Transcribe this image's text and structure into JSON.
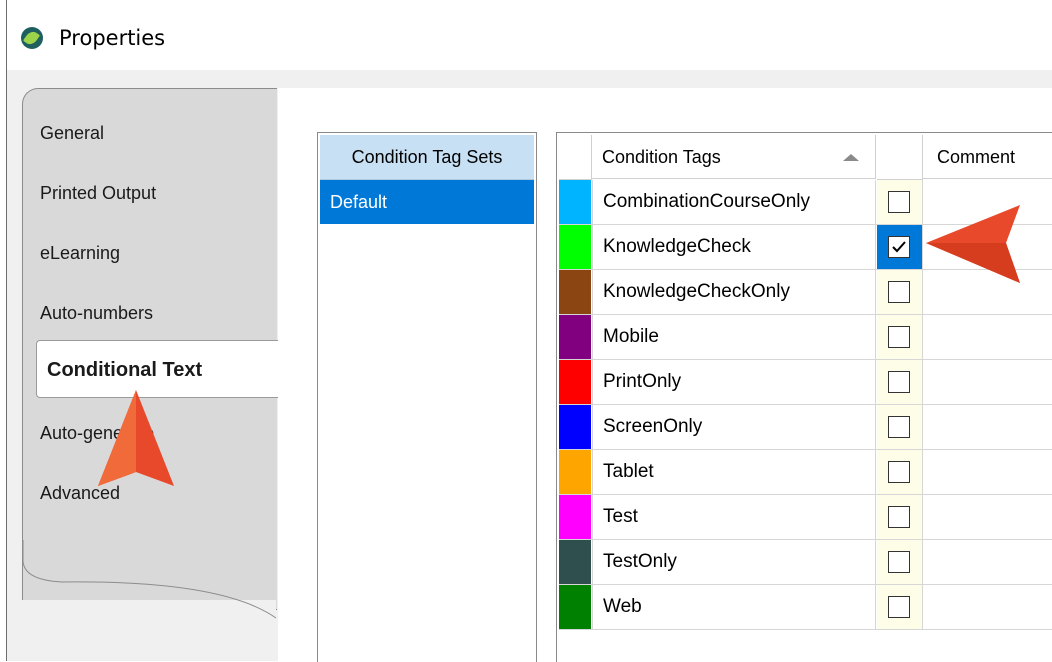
{
  "window": {
    "title": "Properties",
    "icon": "app-leaf-icon"
  },
  "tabs": [
    {
      "label": "General",
      "active": false
    },
    {
      "label": "Printed Output",
      "active": false
    },
    {
      "label": "eLearning",
      "active": false
    },
    {
      "label": "Auto-numbers",
      "active": false
    },
    {
      "label": "Conditional Text",
      "active": true
    },
    {
      "label": "Auto-generate",
      "active": false
    },
    {
      "label": "Advanced",
      "active": false
    }
  ],
  "tag_sets": {
    "header": "Condition Tag Sets",
    "items": [
      {
        "label": "Default",
        "selected": true
      }
    ]
  },
  "tags_grid": {
    "headers": {
      "tags": "Condition Tags",
      "comment": "Comment",
      "sort": "sort-ascending-icon"
    },
    "rows": [
      {
        "name": "CombinationCourseOnly",
        "color": "#00b4ff",
        "checked": false
      },
      {
        "name": "KnowledgeCheck",
        "color": "#00ff00",
        "checked": true
      },
      {
        "name": "KnowledgeCheckOnly",
        "color": "#8b4513",
        "checked": false
      },
      {
        "name": "Mobile",
        "color": "#800080",
        "checked": false
      },
      {
        "name": "PrintOnly",
        "color": "#ff0000",
        "checked": false
      },
      {
        "name": "ScreenOnly",
        "color": "#0000ff",
        "checked": false
      },
      {
        "name": "Tablet",
        "color": "#ffa500",
        "checked": false
      },
      {
        "name": "Test",
        "color": "#ff00ff",
        "checked": false
      },
      {
        "name": "TestOnly",
        "color": "#2f4f4f",
        "checked": false
      },
      {
        "name": "Web",
        "color": "#008000",
        "checked": false
      }
    ]
  },
  "annotations": {
    "arrow_color": "#e8492a"
  }
}
